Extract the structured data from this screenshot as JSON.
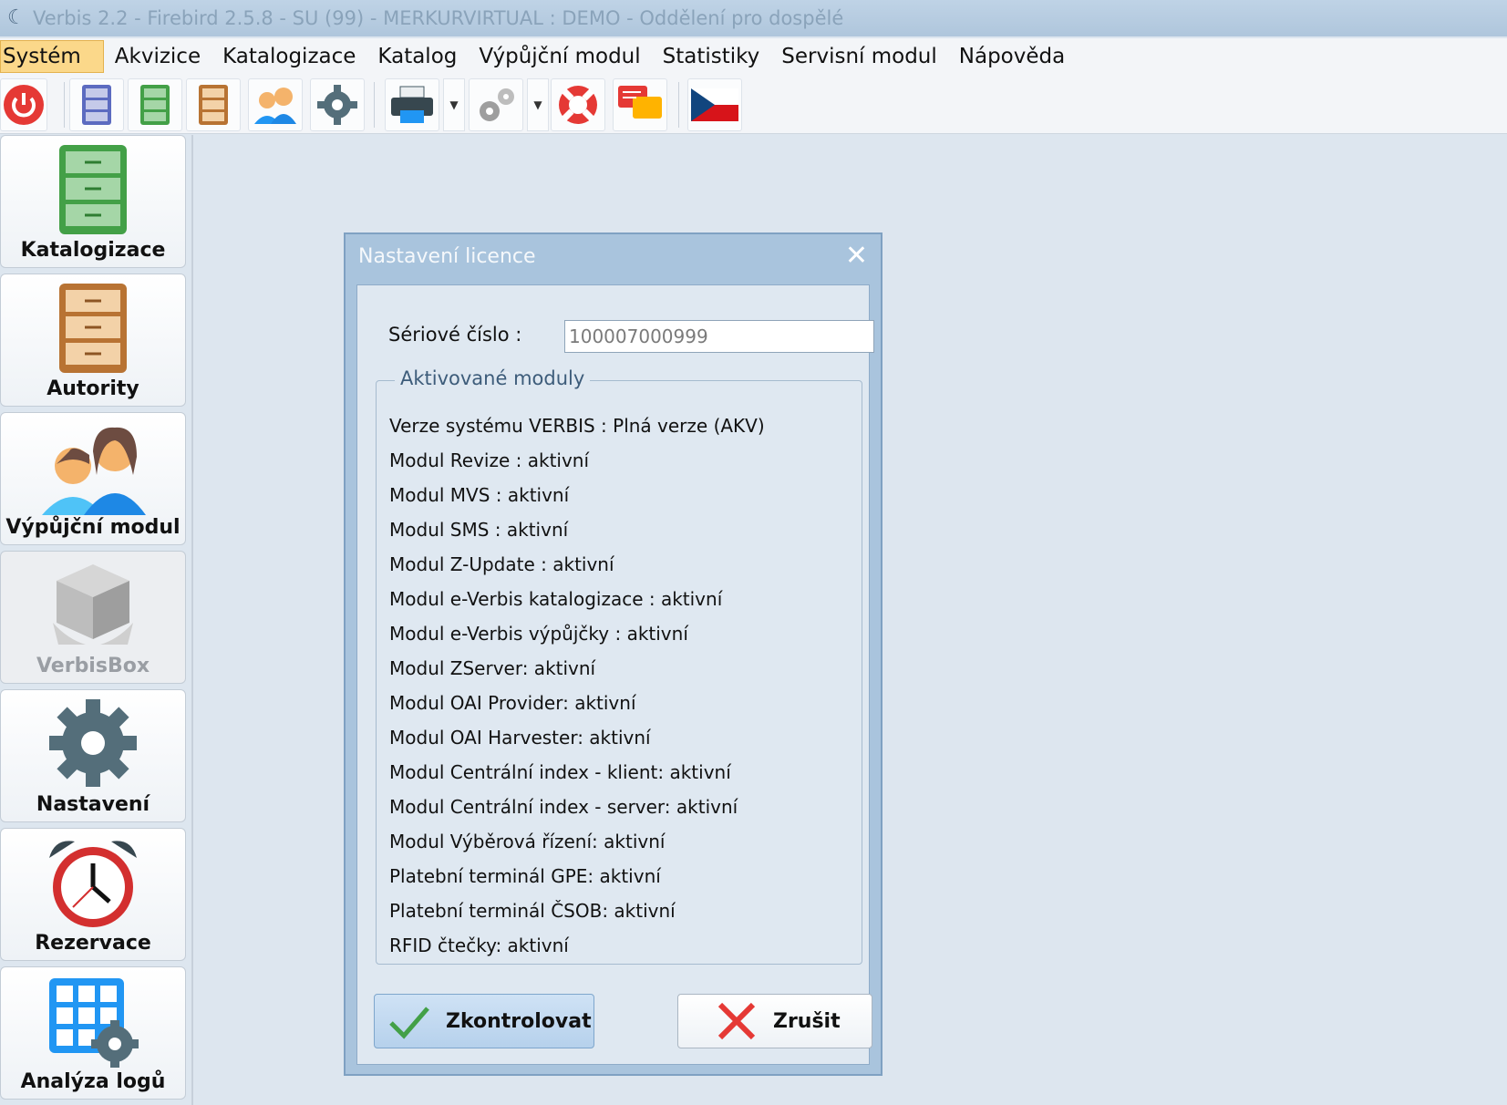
{
  "window": {
    "title": "Verbis 2.2 - Firebird 2.5.8 - SU (99) - MERKURVIRTUAL : DEMO - Oddělení pro dospělé"
  },
  "menu": {
    "items": [
      "Systém",
      "Akvizice",
      "Katalogizace",
      "Katalog",
      "Výpůjční modul",
      "Statistiky",
      "Servisní modul",
      "Nápověda"
    ],
    "active_index": 0
  },
  "toolbar": {
    "icons": [
      "power-icon",
      "blue-cabinet-icon",
      "green-cabinet-icon",
      "brown-cabinet-icon",
      "users-icon",
      "gear-icon",
      "printer-icon",
      "gears-icon",
      "lifebuoy-icon",
      "chat-icon",
      "czech-flag-icon"
    ]
  },
  "sidebar": {
    "items": [
      {
        "label": "Katalogizace",
        "icon": "green-cabinet-icon",
        "enabled": true
      },
      {
        "label": "Autority",
        "icon": "brown-cabinet-icon",
        "enabled": true
      },
      {
        "label": "Výpůjční modul",
        "icon": "users-icon",
        "enabled": true
      },
      {
        "label": "VerbisBox",
        "icon": "box-icon",
        "enabled": false
      },
      {
        "label": "Nastavení",
        "icon": "gear-icon",
        "enabled": true
      },
      {
        "label": "Rezervace",
        "icon": "alarm-clock-icon",
        "enabled": true
      },
      {
        "label": "Analýza logů",
        "icon": "grid-gear-icon",
        "enabled": true
      }
    ]
  },
  "dialog": {
    "title": "Nastavení licence",
    "serial_label": "Sériové číslo :",
    "serial_value": "100007000999",
    "group_title": "Aktivované moduly",
    "modules": [
      "Verze systému VERBIS : Plná verze (AKV)",
      "Modul Revize : aktivní",
      "Modul MVS : aktivní",
      "Modul SMS : aktivní",
      "Modul Z-Update : aktivní",
      "Modul e-Verbis katalogizace : aktivní",
      "Modul e-Verbis výpůjčky : aktivní",
      "Modul ZServer: aktivní",
      "Modul OAI Provider: aktivní",
      "Modul OAI Harvester: aktivní",
      "Modul Centrální index - klient: aktivní",
      "Modul Centrální index - server: aktivní",
      "Modul Výběrová řízení: aktivní",
      "Platební terminál GPE: aktivní",
      "Platební terminál ČSOB: aktivní",
      "RFID čtečky: aktivní"
    ],
    "check_button": "Zkontrolovat",
    "cancel_button": "Zrušit"
  },
  "colors": {
    "accent_menu": "#fbd88a",
    "dialog_frame": "#a9c4dd",
    "background": "#dde6ef"
  }
}
